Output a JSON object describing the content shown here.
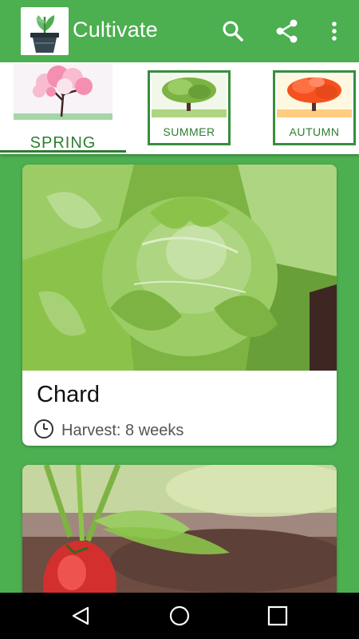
{
  "app": {
    "title": "Cultivate"
  },
  "colors": {
    "primary": "#4CAF50",
    "tab_text": "#2E7D32",
    "tab_border": "#388E3C"
  },
  "toolbar": {
    "icons": [
      "plant-pot-logo",
      "search-icon",
      "share-icon",
      "more-vert-icon"
    ]
  },
  "seasons": {
    "selected": "SPRING",
    "tabs": [
      {
        "label": "SPRING",
        "icon": "blossom-tree"
      },
      {
        "label": "SUMMER",
        "icon": "green-tree"
      },
      {
        "label": "AUTUMN",
        "icon": "orange-tree"
      }
    ]
  },
  "plants": [
    {
      "name": "Chard",
      "harvest": "Harvest: 8 weeks",
      "image": "chard-leaves-photo"
    },
    {
      "name": "",
      "harvest": "",
      "image": "radish-photo"
    }
  ],
  "navbar": {
    "icons": [
      "back-icon",
      "home-icon",
      "recents-icon"
    ]
  }
}
